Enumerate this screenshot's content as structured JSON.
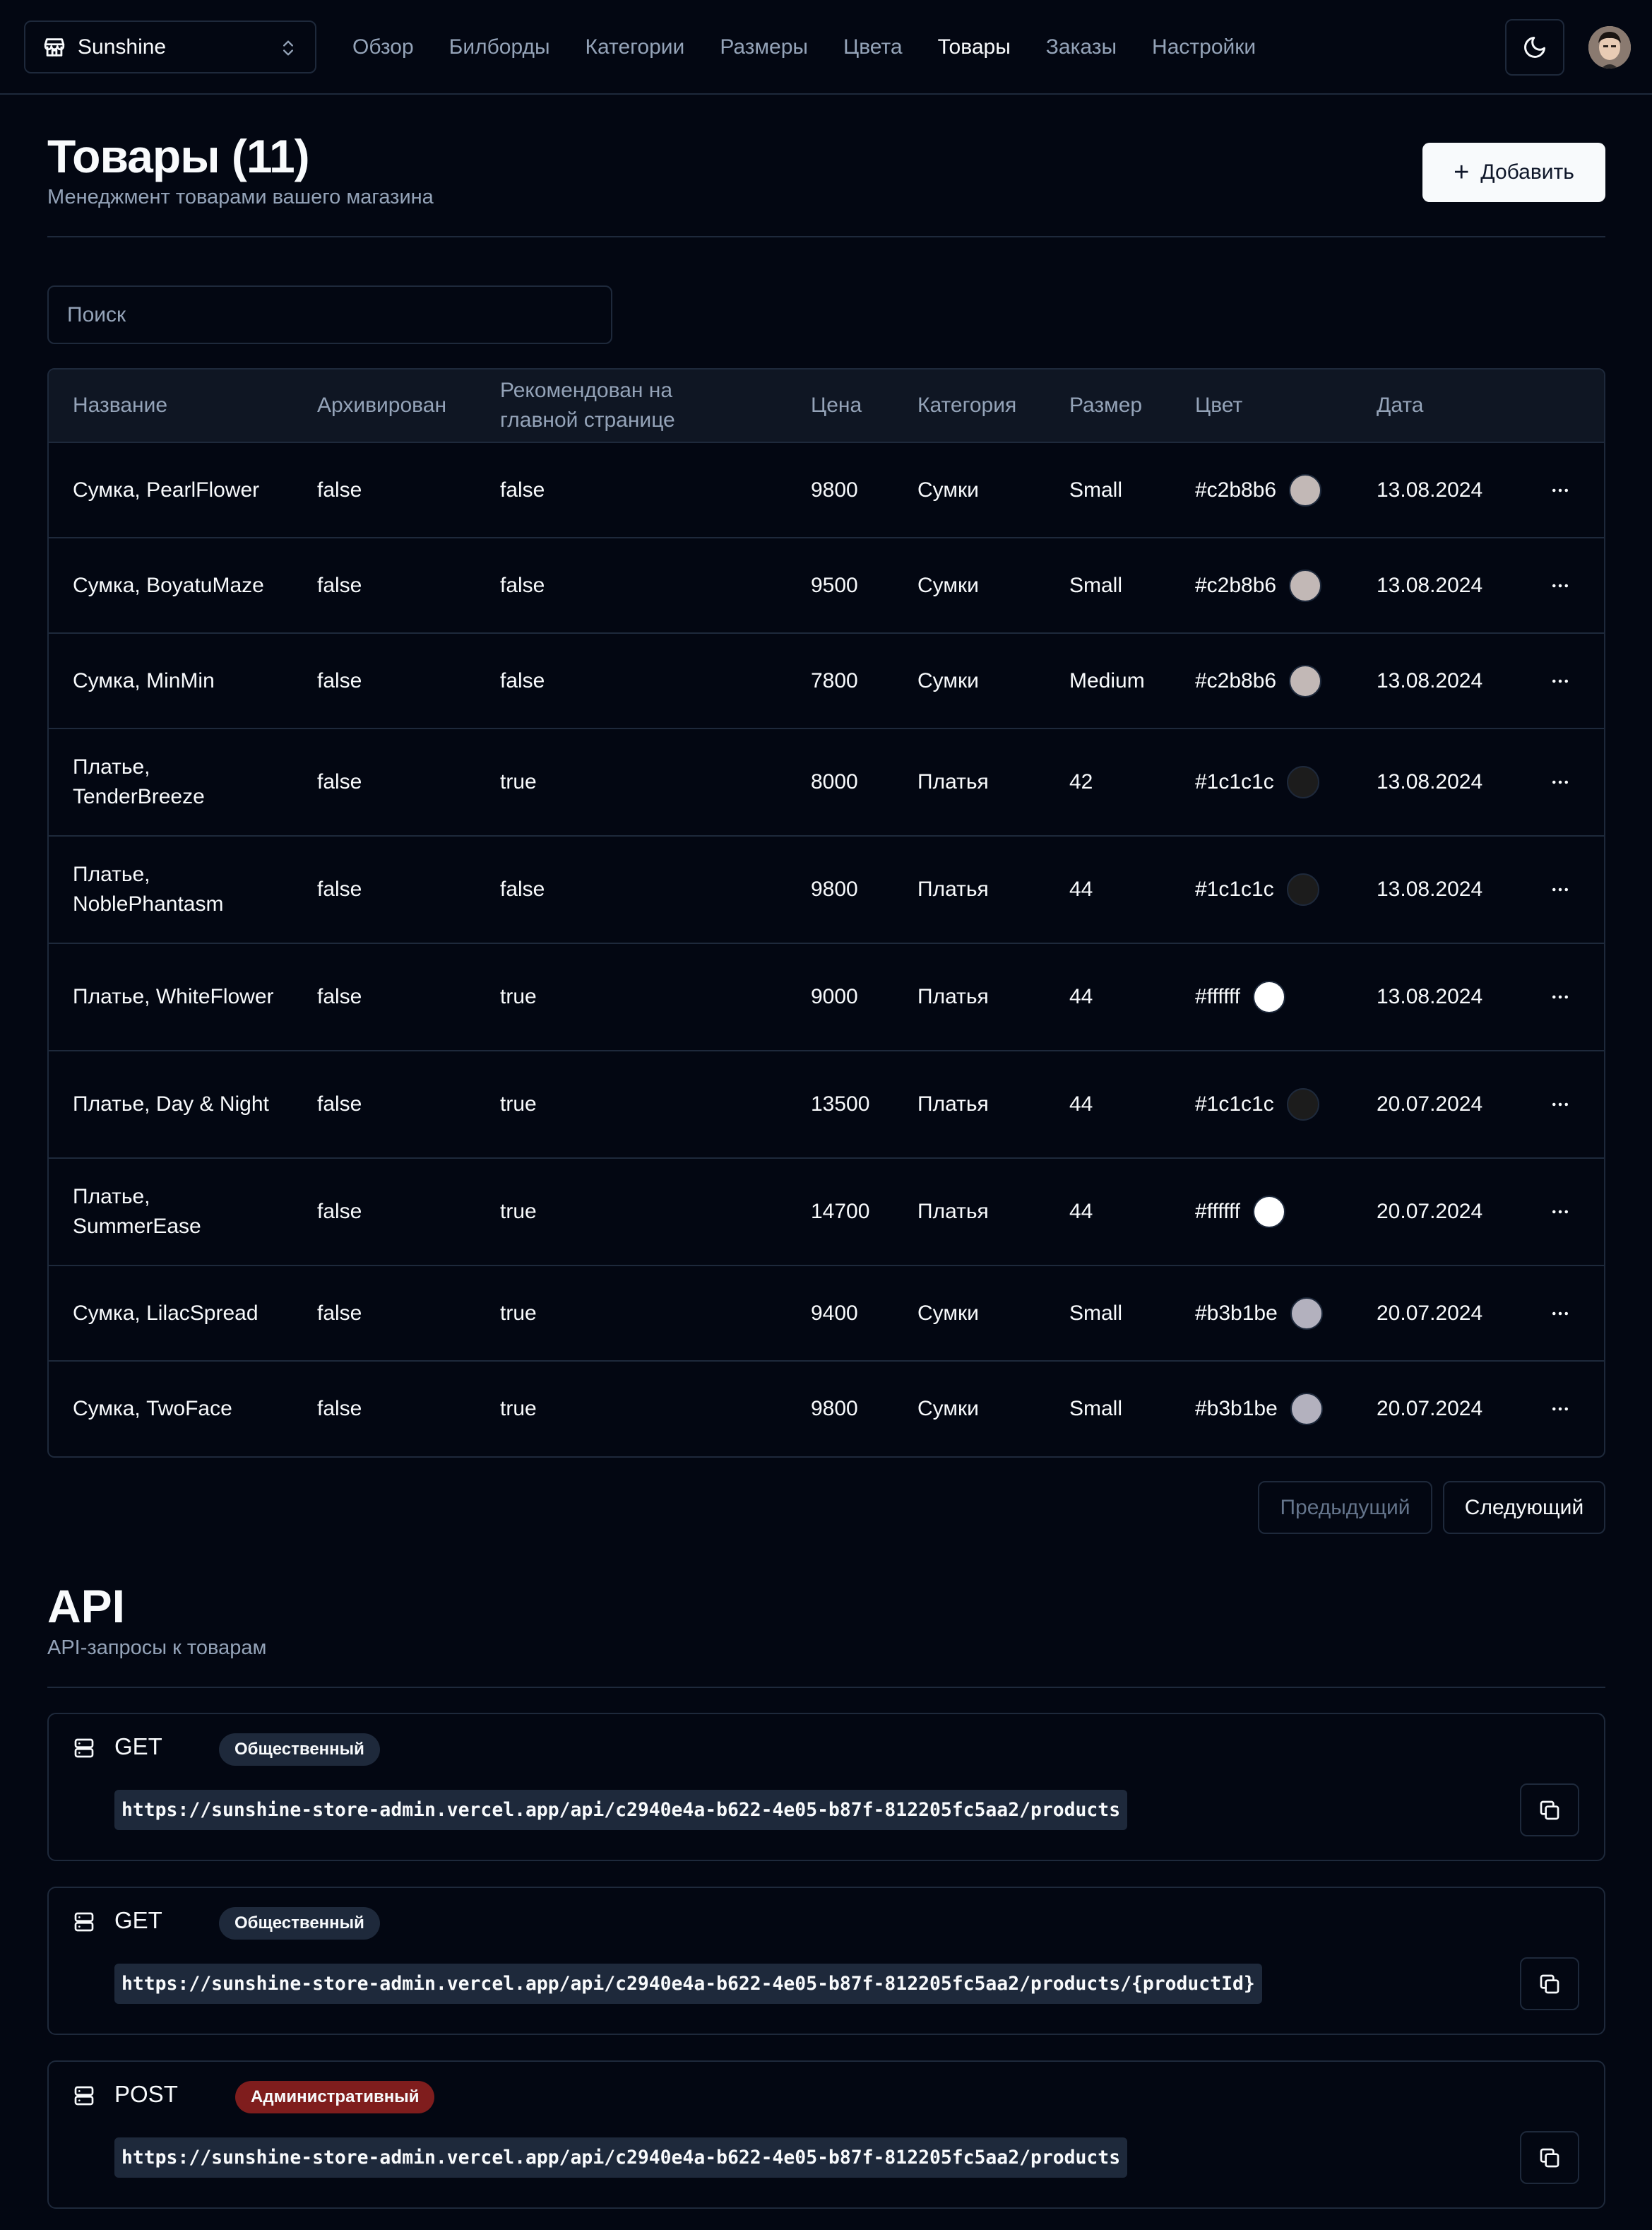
{
  "header": {
    "store_name": "Sunshine",
    "nav": [
      "Обзор",
      "Билборды",
      "Категории",
      "Размеры",
      "Цвета",
      "Товары",
      "Заказы",
      "Настройки"
    ],
    "active_nav": "Товары"
  },
  "heading": {
    "title": "Товары (11)",
    "subtitle": "Менеджмент товарами вашего магазина",
    "add_button": "Добавить"
  },
  "search": {
    "placeholder": "Поиск"
  },
  "table": {
    "columns": [
      "Название",
      "Архивирован",
      "Рекомендован на главной странице",
      "Цена",
      "Категория",
      "Размер",
      "Цвет",
      "Дата"
    ],
    "rows": [
      {
        "name": "Сумка, PearlFlower",
        "archived": "false",
        "featured": "false",
        "price": "9800",
        "category": "Сумки",
        "size": "Small",
        "color": "#c2b8b6",
        "date": "13.08.2024"
      },
      {
        "name": "Сумка, BoyatuMaze",
        "archived": "false",
        "featured": "false",
        "price": "9500",
        "category": "Сумки",
        "size": "Small",
        "color": "#c2b8b6",
        "date": "13.08.2024"
      },
      {
        "name": "Сумка, MinMin",
        "archived": "false",
        "featured": "false",
        "price": "7800",
        "category": "Сумки",
        "size": "Medium",
        "color": "#c2b8b6",
        "date": "13.08.2024"
      },
      {
        "name": "Платье, TenderBreeze",
        "archived": "false",
        "featured": "true",
        "price": "8000",
        "category": "Платья",
        "size": "42",
        "color": "#1c1c1c",
        "date": "13.08.2024"
      },
      {
        "name": "Платье, NoblePhantasm",
        "archived": "false",
        "featured": "false",
        "price": "9800",
        "category": "Платья",
        "size": "44",
        "color": "#1c1c1c",
        "date": "13.08.2024"
      },
      {
        "name": "Платье, WhiteFlower",
        "archived": "false",
        "featured": "true",
        "price": "9000",
        "category": "Платья",
        "size": "44",
        "color": "#ffffff",
        "date": "13.08.2024"
      },
      {
        "name": "Платье, Day & Night",
        "archived": "false",
        "featured": "true",
        "price": "13500",
        "category": "Платья",
        "size": "44",
        "color": "#1c1c1c",
        "date": "20.07.2024"
      },
      {
        "name": "Платье, SummerEase",
        "archived": "false",
        "featured": "true",
        "price": "14700",
        "category": "Платья",
        "size": "44",
        "color": "#ffffff",
        "date": "20.07.2024"
      },
      {
        "name": "Сумка, LilacSpread",
        "archived": "false",
        "featured": "true",
        "price": "9400",
        "category": "Сумки",
        "size": "Small",
        "color": "#b3b1be",
        "date": "20.07.2024"
      },
      {
        "name": "Сумка, TwoFace",
        "archived": "false",
        "featured": "true",
        "price": "9800",
        "category": "Сумки",
        "size": "Small",
        "color": "#b3b1be",
        "date": "20.07.2024"
      }
    ]
  },
  "pagination": {
    "prev": "Предыдущий",
    "next": "Следующий"
  },
  "api": {
    "title": "API",
    "subtitle": "API-запросы к товарам",
    "routes": [
      {
        "method": "GET",
        "badge": "Общественный",
        "type": "public",
        "url": "https://sunshine-store-admin.vercel.app/api/c2940e4a-b622-4e05-b87f-812205fc5aa2/products"
      },
      {
        "method": "GET",
        "badge": "Общественный",
        "type": "public",
        "url": "https://sunshine-store-admin.vercel.app/api/c2940e4a-b622-4e05-b87f-812205fc5aa2/products/{productId}"
      },
      {
        "method": "POST",
        "badge": "Административный",
        "type": "admin",
        "url": "https://sunshine-store-admin.vercel.app/api/c2940e4a-b622-4e05-b87f-812205fc5aa2/products"
      }
    ]
  },
  "icons": {
    "store": "store-icon",
    "chevrons": "chevrons-up-down-icon",
    "theme": "moon-icon",
    "more": "more-horizontal-icon",
    "server": "server-icon",
    "copy": "copy-icon",
    "plus": "plus-icon"
  }
}
